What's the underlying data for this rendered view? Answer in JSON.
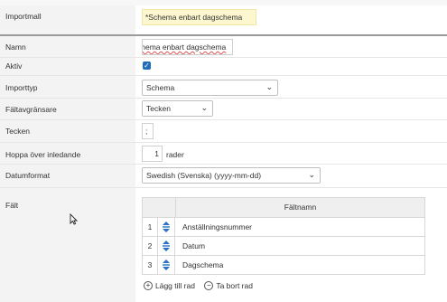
{
  "form": {
    "import_template": {
      "label": "Importmall",
      "value": "*Schema enbart dagschema"
    },
    "name": {
      "label": "Namn",
      "value": "chema enbart dagschema"
    },
    "active": {
      "label": "Aktiv",
      "checked": true
    },
    "import_type": {
      "label": "Importtyp",
      "value": "Schema"
    },
    "field_delimiter": {
      "label": "Fältavgränsare",
      "value": "Tecken"
    },
    "character": {
      "label": "Tecken",
      "value": ";"
    },
    "skip_leading": {
      "label": "Hoppa över inledande",
      "value": "1",
      "suffix": "rader"
    },
    "date_format": {
      "label": "Datumformat",
      "value": "Swedish (Svenska) (yyyy-mm-dd)"
    },
    "fields": {
      "label": "Fält",
      "column_header": "Fältnamn",
      "rows": [
        {
          "num": "1",
          "name": "Anställningsnummer"
        },
        {
          "num": "2",
          "name": "Datum"
        },
        {
          "num": "3",
          "name": "Dagschema"
        }
      ],
      "add_label": "Lägg till rad",
      "remove_label": "Ta bort rad"
    }
  },
  "icons": {
    "checkbox": "check-icon",
    "select_arrow": "chevron-down-icon",
    "drag_handle": "drag-handle-icon",
    "add": "plus-circle-icon",
    "remove": "minus-circle-icon",
    "cursor": "mouse-pointer-icon"
  },
  "colors": {
    "accent": "#1f6fb8",
    "highlight": "#fdf7cf",
    "label_column": "#f3f3f3"
  }
}
